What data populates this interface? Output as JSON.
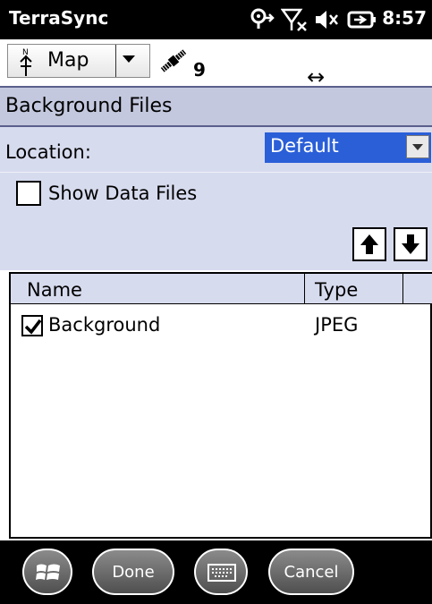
{
  "status_bar": {
    "app_title": "TerraSync",
    "time": "8:57",
    "icons": [
      "gps-connection-icon",
      "no-signal-icon",
      "volume-muted-icon",
      "battery-charging-icon"
    ]
  },
  "toolbar": {
    "map_label": "Map",
    "satellite_count": "9",
    "pan_symbol": "↔"
  },
  "panel": {
    "title": "Background Files",
    "location_label": "Location:",
    "location_value": "Default",
    "show_data_files_label": "Show Data Files",
    "show_data_files_checked": false
  },
  "list": {
    "columns": [
      "Name",
      "Type"
    ],
    "rows": [
      {
        "name": "Background",
        "type": "JPEG",
        "checked": true
      }
    ]
  },
  "bottom_bar": {
    "done_label": "Done",
    "cancel_label": "Cancel"
  },
  "colors": {
    "panel_bg": "#d7dbee",
    "header_bg": "#c3c8de",
    "selection_blue": "#2a5fd8"
  }
}
